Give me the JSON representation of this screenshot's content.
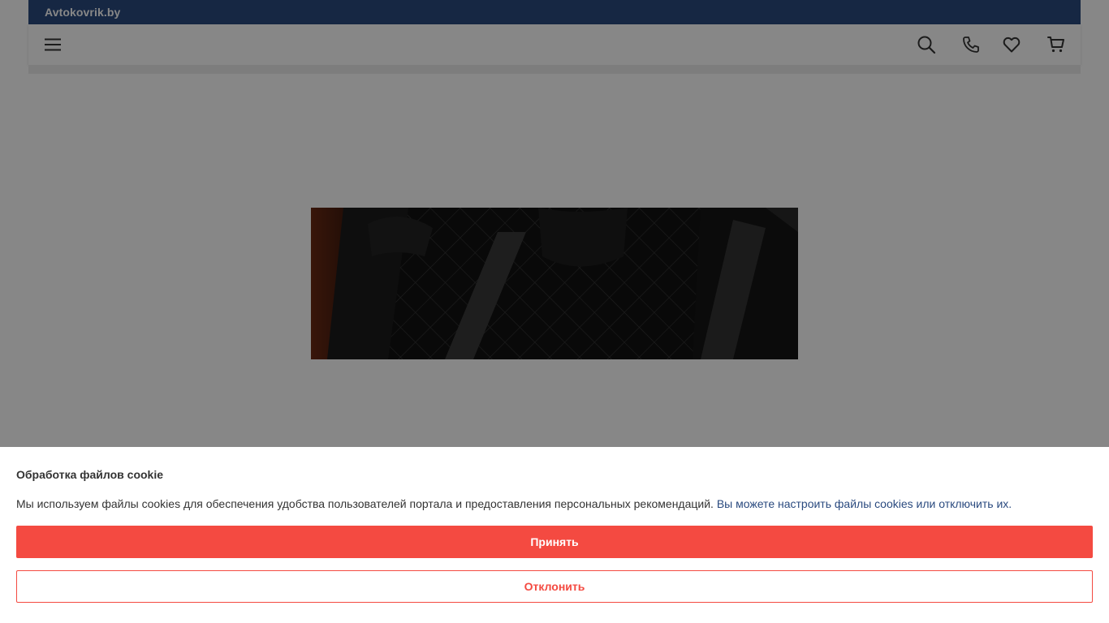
{
  "header": {
    "brand": "Avtokovrik.by"
  },
  "navbar": {
    "menu_icon": "hamburger-menu-icon",
    "search_icon": "search-icon",
    "phone_icon": "phone-icon",
    "favorites_icon": "heart-icon",
    "cart_icon": "cart-icon"
  },
  "banner": {
    "image": "car-seat-cover-banner"
  },
  "cookie": {
    "title": "Обработка файлов cookie",
    "text": "Мы используем файлы cookies для обеспечения удобства пользователей портала и предоставления персональных рекомендаций.",
    "link_text": "Вы можете настроить файлы cookies или отключить их.",
    "accept_label": "Принять",
    "decline_label": "Отклонить"
  },
  "colors": {
    "brand_bar": "#2a4a7f",
    "accent": "#f44a41",
    "overlay": "rgba(0,0,0,0.47)"
  }
}
